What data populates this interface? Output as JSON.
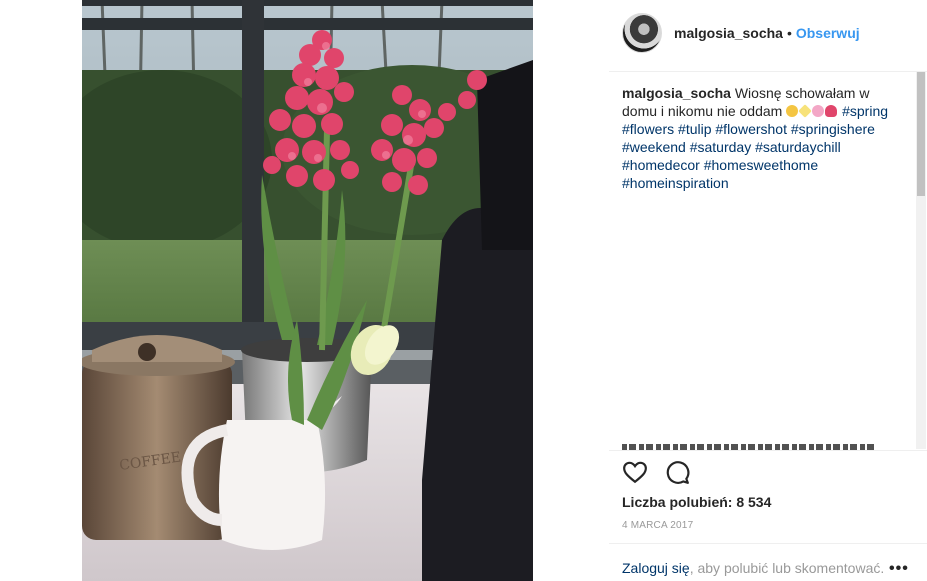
{
  "post": {
    "username": "malgosia_socha",
    "separator": "•",
    "follow_label": "Obserwuj",
    "caption": {
      "username": "malgosia_socha",
      "text": "Wiosnę schowałam w domu i nikomu nie oddam",
      "emoji": [
        "grinning-face-emoji",
        "sparkle-emoji",
        "blossom-emoji",
        "tulip-emoji"
      ],
      "hashtags": [
        "#spring",
        "#flowers",
        "#tulip",
        "#flowershot",
        "#springishere",
        "#weekend",
        "#saturday",
        "#saturdaychill",
        "#homedecor",
        "#homesweethome",
        "#homeinspiration"
      ]
    },
    "likes_label": "Liczba polubień: 8 534",
    "date": "4 MARCA 2017",
    "login": {
      "link": "Zaloguj się",
      "rest": ", aby polubić lub skomentować."
    },
    "more_label": "•••"
  },
  "icons": {
    "like": "heart-icon",
    "comment": "comment-icon",
    "more": "more-options-icon"
  },
  "colors": {
    "link_blue": "#3897f0",
    "hashtag_blue": "#003569",
    "muted": "#999999"
  }
}
